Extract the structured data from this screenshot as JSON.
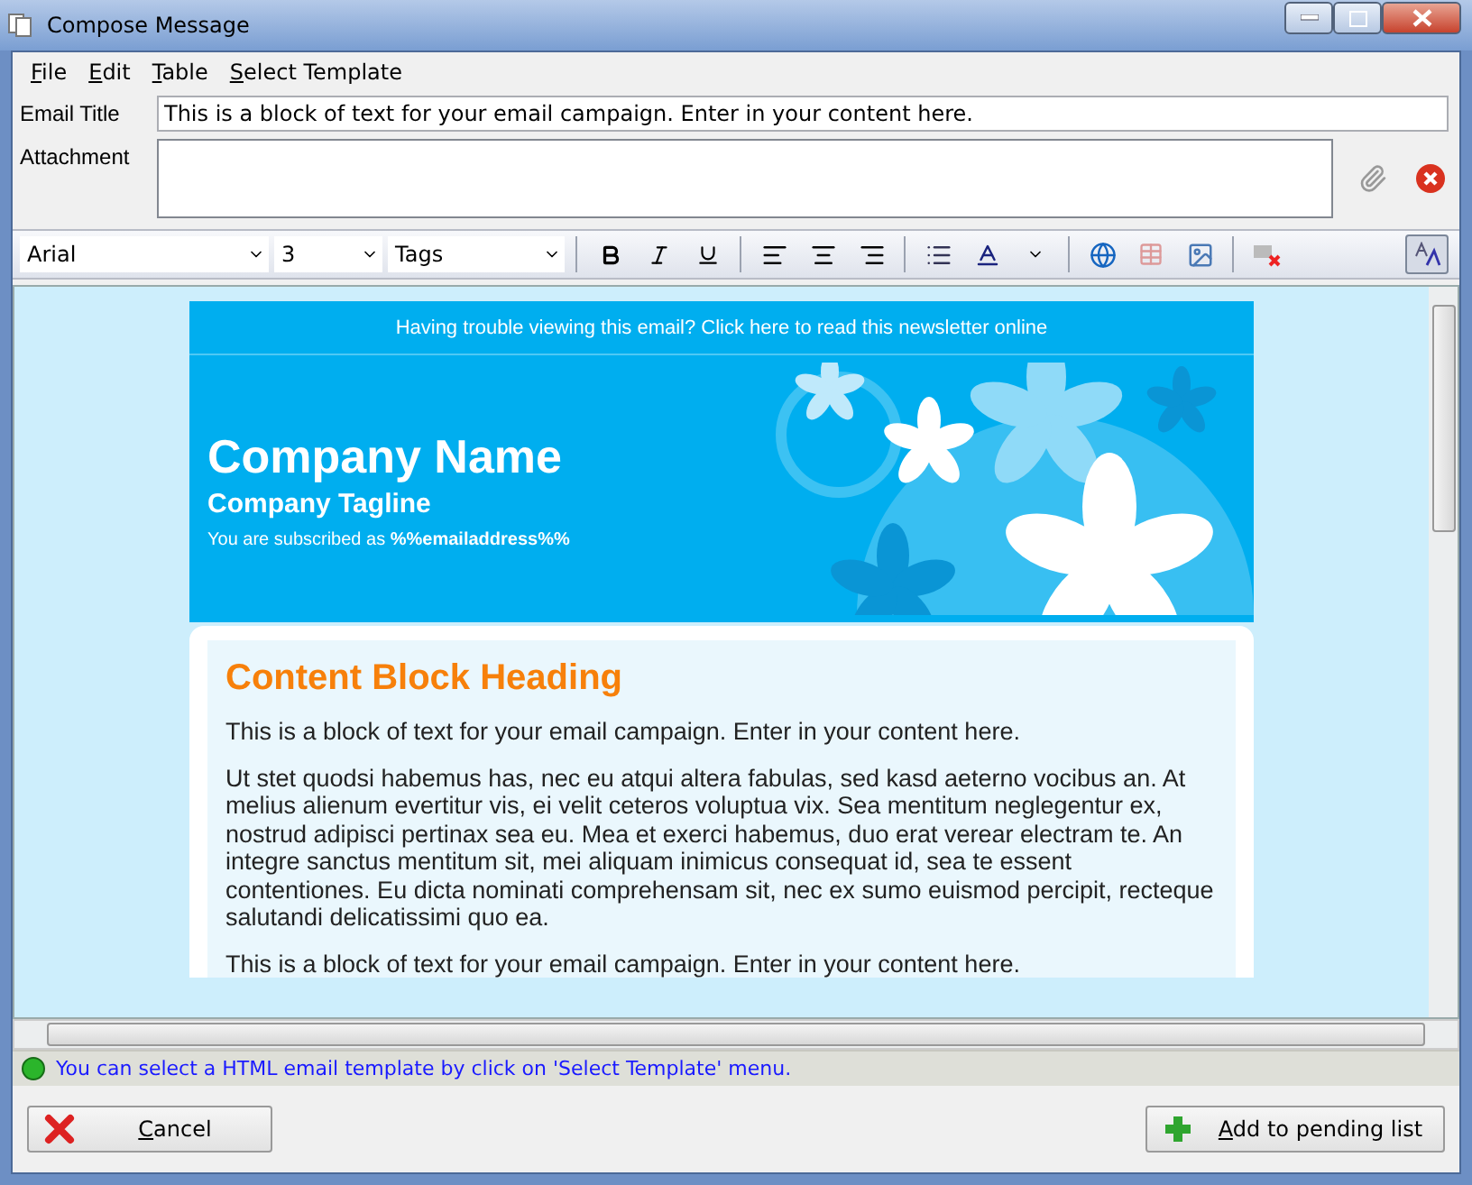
{
  "window": {
    "title": "Compose Message"
  },
  "menu": [
    "File",
    "Edit",
    "Table",
    "Select Template"
  ],
  "email_title": {
    "label": "Email Title",
    "value": "This is a block of text for your email campaign. Enter in your content here."
  },
  "attachment": {
    "label": "Attachment"
  },
  "toolbar": {
    "font": "Arial",
    "size": "3",
    "tags": "Tags"
  },
  "email": {
    "preheader": "Having trouble viewing this email? Click here to read this newsletter online",
    "company_name": "Company Name",
    "tagline": "Company Tagline",
    "subscribed": "You are subscribed as **%%emailaddress%%**",
    "heading": "Content Block Heading",
    "paragraphs": [
      "This is a block of text for your email campaign. Enter in your content here.",
      "Ut stet quodsi habemus has, nec eu atqui altera fabulas, sed kasd aeterno vocibus an. At melius alienum evertitur vis, ei velit ceteros voluptua vix. Sea mentitum neglegentur ex, nostrud adipisci pertinax sea eu. Mea et exerci habemus, duo erat verear electram te. An integre sanctus mentitum sit, mei aliquam inimicus consequat id, sea te essent contentiones. Eu dicta nominati comprehensam sit, nec ex sumo euismod percipit, recteque salutandi delicatissimi quo ea.",
      "This is a block of text for your email campaign. Enter in your content here."
    ]
  },
  "status": "You can select a HTML email template by click on 'Select Template' menu.",
  "buttons": [
    {
      "label": "Cancel",
      "kind": "cancel"
    },
    {
      "label": "Add to pending list",
      "kind": "add"
    }
  ]
}
